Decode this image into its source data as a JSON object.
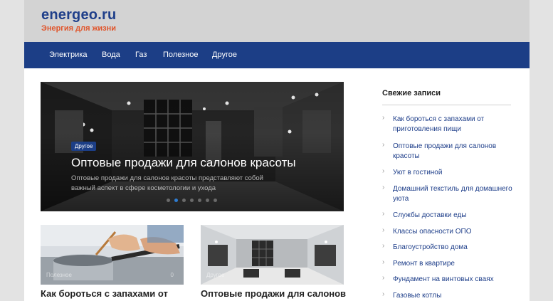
{
  "header": {
    "site_title": "energeo.ru",
    "tagline": "Энергия для жизни"
  },
  "nav": {
    "items": [
      "Электрика",
      "Вода",
      "Газ",
      "Полезное",
      "Другое"
    ]
  },
  "hero": {
    "category": "Другое",
    "title": "Оптовые продажи для салонов красоты",
    "excerpt": "Оптовые продажи для салонов красоты представляют собой важный аспект в сфере косметологии и ухода",
    "slide_count": 7,
    "active_slide": 2
  },
  "cards": [
    {
      "category": "Полезное",
      "comments": "0",
      "title": "Как бороться с запахами от приготовления пищи"
    },
    {
      "category": "Другое",
      "comments": "",
      "title": "Оптовые продажи для салонов красоты"
    }
  ],
  "sidebar": {
    "title": "Свежие записи",
    "items": [
      "Как бороться с запахами от приготовления пищи",
      "Оптовые продажи для салонов красоты",
      "Уют в гостиной",
      "Домашний текстиль для домашнего уюта",
      "Службы доставки еды",
      "Классы опасности ОПО",
      "Благоустройство дома",
      "Ремонт в квартире",
      "Фундамент на винтовых сваях",
      "Газовые котлы"
    ]
  },
  "icons": {
    "sidebar_bullet": "chevron-right-icon"
  },
  "colors": {
    "brand": "#1c3e86",
    "accent": "#e0542a",
    "link": "#1f3f8a"
  }
}
